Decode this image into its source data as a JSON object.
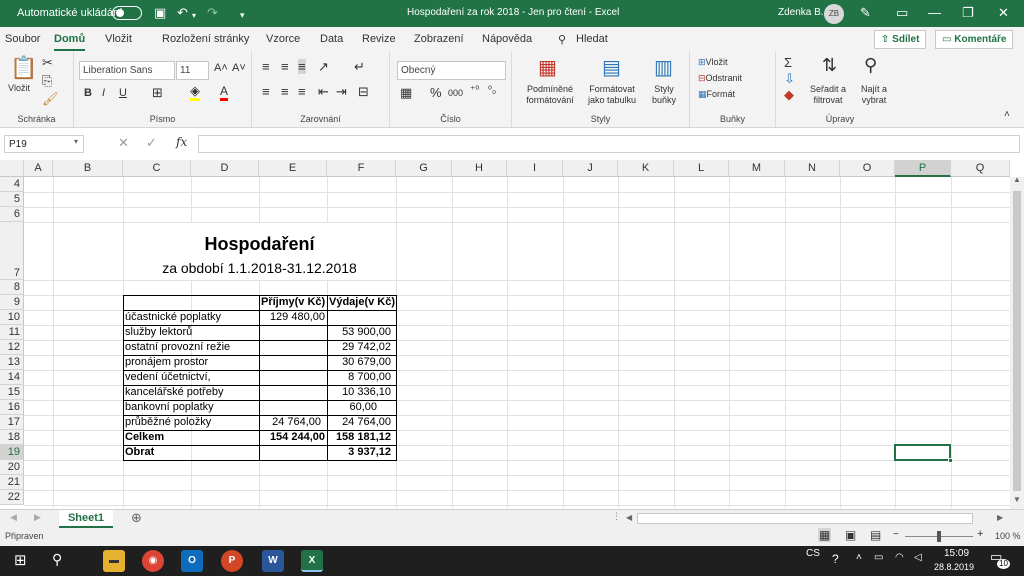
{
  "titlebar": {
    "autosave": "Automatické ukládání",
    "title": "Hospodaření za rok 2018  -  Jen pro čtení  -  Excel",
    "user": "Zdenka B.",
    "initials": "ZB"
  },
  "menu": {
    "items": [
      "Soubor",
      "Domů",
      "Vložit",
      "Rozložení stránky",
      "Vzorce",
      "Data",
      "Revize",
      "Zobrazení",
      "Nápověda"
    ],
    "search": "Hledat",
    "share": "Sdílet",
    "comments": "Komentáře"
  },
  "ribbon": {
    "paste": "Vložit",
    "clipboard": "Schránka",
    "font_name": "Liberation Sans",
    "font_size": "11",
    "font_group": "Písmo",
    "align_group": "Zarovnání",
    "number_format": "Obecný",
    "percent": "%",
    "thousands": "000",
    "number_group": "Číslo",
    "cond_format": "Podmíněné formátování",
    "format_table": "Formátovat jako tabulku",
    "cell_styles": "Styly buňky",
    "styles_group": "Styly",
    "insert": "Vložit",
    "delete": "Odstranit",
    "format": "Formát",
    "cells_group": "Buňky",
    "sort": "Seřadit a filtrovat",
    "find": "Najít a vybrat",
    "edit_group": "Úpravy",
    "bold": "B",
    "italic": "I",
    "underline": "U"
  },
  "formula": {
    "namebox": "P19",
    "fx": "fx"
  },
  "columns": [
    "A",
    "B",
    "C",
    "D",
    "E",
    "F",
    "G",
    "H",
    "I",
    "J",
    "K",
    "L",
    "M",
    "N",
    "O",
    "P",
    "Q"
  ],
  "rows": [
    "4",
    "5",
    "6",
    "7",
    "8",
    "9",
    "10",
    "11",
    "12",
    "13",
    "14",
    "15",
    "16",
    "17",
    "18",
    "19",
    "20",
    "21",
    "22"
  ],
  "sheet": {
    "title": "Hospodaření",
    "subtitle": "za období 1.1.2018-31.12.2018",
    "h_income": "Příjmy(v Kč)",
    "h_expense": "Výdaje(v Kč)",
    "rows": [
      {
        "label": "účastnické poplatky",
        "income": "129 480,00",
        "expense": ""
      },
      {
        "label": "služby lektorů",
        "income": "",
        "expense": "53 900,00"
      },
      {
        "label": "ostatní provozní režie",
        "income": "",
        "expense": "29 742,02"
      },
      {
        "label": "pronájem prostor",
        "income": "",
        "expense": "30 679,00"
      },
      {
        "label": "vedení účetnictví,",
        "income": "",
        "expense": "8 700,00"
      },
      {
        "label": "kancelářské potřeby",
        "income": "",
        "expense": "10 336,10"
      },
      {
        "label": "bankovní poplatky",
        "income": "",
        "expense": "60,00"
      },
      {
        "label": "průběžné položky",
        "income": "24 764,00",
        "expense": "24 764,00"
      },
      {
        "label": "Celkem",
        "income": "154 244,00",
        "expense": "158 181,12"
      },
      {
        "label": "Obrat",
        "income": "",
        "expense": "3 937,12"
      }
    ]
  },
  "sheettab": "Sheet1",
  "status": {
    "ready": "Připraven",
    "zoom": "100 %"
  },
  "taskbar": {
    "lang": "CS",
    "time": "15:09",
    "date": "28.8.2019",
    "notif": "10"
  },
  "colors": {
    "excel_green": "#217346",
    "selection": "#217346"
  }
}
